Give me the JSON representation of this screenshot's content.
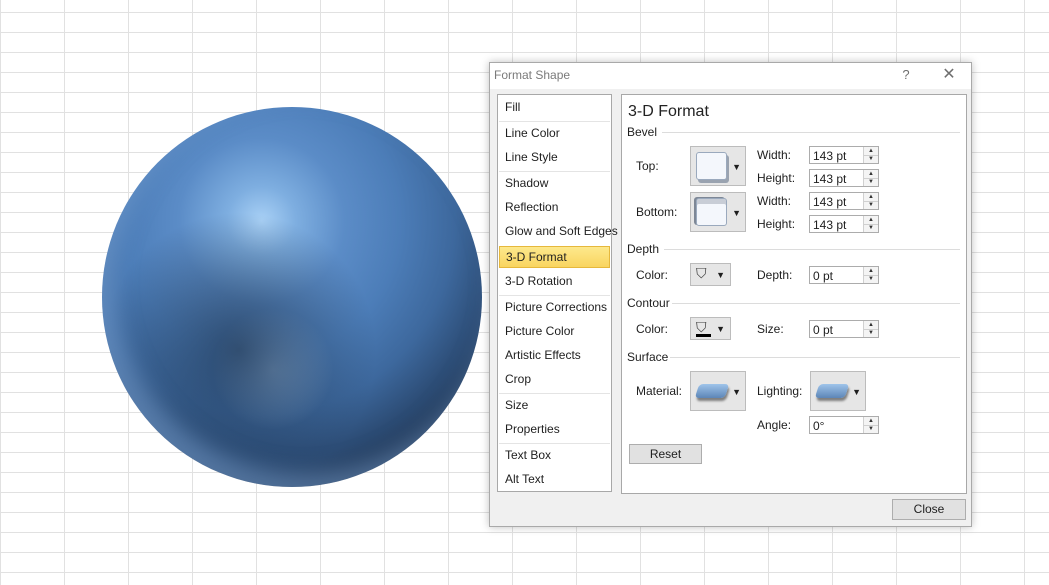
{
  "dialog": {
    "title": "Format Shape",
    "help": "?",
    "close_glyph": "✕",
    "close_button": "Close"
  },
  "nav": {
    "items": [
      "Fill",
      "Line Color",
      "Line Style",
      "Shadow",
      "Reflection",
      "Glow and Soft Edges",
      "3-D Format",
      "3-D Rotation",
      "Picture Corrections",
      "Picture Color",
      "Artistic Effects",
      "Crop",
      "Size",
      "Properties",
      "Text Box",
      "Alt Text"
    ],
    "selected": "3-D Format"
  },
  "panel": {
    "heading": "3-D Format",
    "bevel": {
      "section": "Bevel",
      "top_label": "Top:",
      "bottom_label": "Bottom:",
      "width_label": "Width:",
      "height_label": "Height:",
      "top_width": "143 pt",
      "top_height": "143 pt",
      "bottom_width": "143 pt",
      "bottom_height": "143 pt"
    },
    "depth": {
      "section": "Depth",
      "color_label": "Color:",
      "depth_label": "Depth:",
      "depth_value": "0 pt"
    },
    "contour": {
      "section": "Contour",
      "color_label": "Color:",
      "size_label": "Size:",
      "size_value": "0 pt"
    },
    "surface": {
      "section": "Surface",
      "material_label": "Material:",
      "lighting_label": "Lighting:",
      "angle_label": "Angle:",
      "angle_value": "0°"
    },
    "reset_button": "Reset"
  },
  "icons": {
    "dropdown": "▼",
    "spin_up": "▲",
    "spin_down": "▼",
    "paint_bucket": "⛉"
  },
  "colors": {
    "sphere_highlight": "#a9d1f6",
    "sphere_base": "#4c7db8",
    "selection": "#f9d560"
  }
}
